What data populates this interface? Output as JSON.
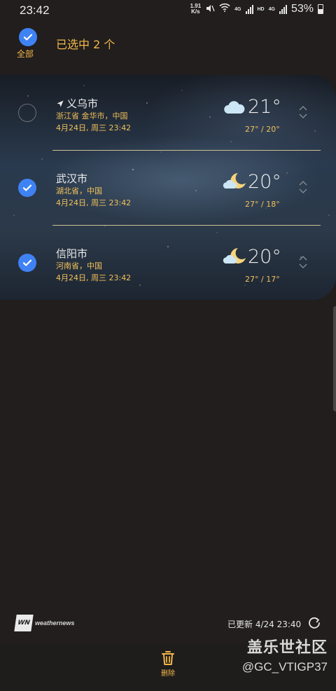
{
  "status_bar": {
    "time": "23:42",
    "speed_value": "1.91",
    "speed_unit": "K/s",
    "net_label_1": "4G",
    "net_label_2": "HD",
    "net_label_3": "4G",
    "battery_percent": "53%",
    "battery_level": 0.53
  },
  "header": {
    "select_all_label": "全部",
    "selected_count_text": "已选中 2 个"
  },
  "locations": [
    {
      "city": "义乌市",
      "is_current_location": true,
      "region": "浙江省 金华市，中国",
      "datetime": "4月24日, 周三 23:42",
      "weather_icon": "cloudy-icon",
      "temp": "21°",
      "range": "27° / 20°",
      "selected": false
    },
    {
      "city": "武汉市",
      "is_current_location": false,
      "region": "湖北省，中国",
      "datetime": "4月24日, 周三 23:42",
      "weather_icon": "moon-cloud-icon",
      "temp": "20°",
      "range": "27° / 18°",
      "selected": true
    },
    {
      "city": "信阳市",
      "is_current_location": false,
      "region": "河南省，中国",
      "datetime": "4月24日, 周三 23:42",
      "weather_icon": "moon-cloud-icon",
      "temp": "20°",
      "range": "27° / 17°",
      "selected": true
    }
  ],
  "footer": {
    "provider_badge": "WN",
    "provider_name": "weathernews",
    "updated_text": "已更新 4/24 23:40"
  },
  "bottom_bar": {
    "delete_label": "删除"
  },
  "watermark": {
    "line1": "盖乐世社区",
    "line2": "@GC_VTIGP37"
  },
  "colors": {
    "accent_blue": "#3f82f4",
    "accent_gold": "#f2b64a",
    "background": "#211e1d"
  }
}
